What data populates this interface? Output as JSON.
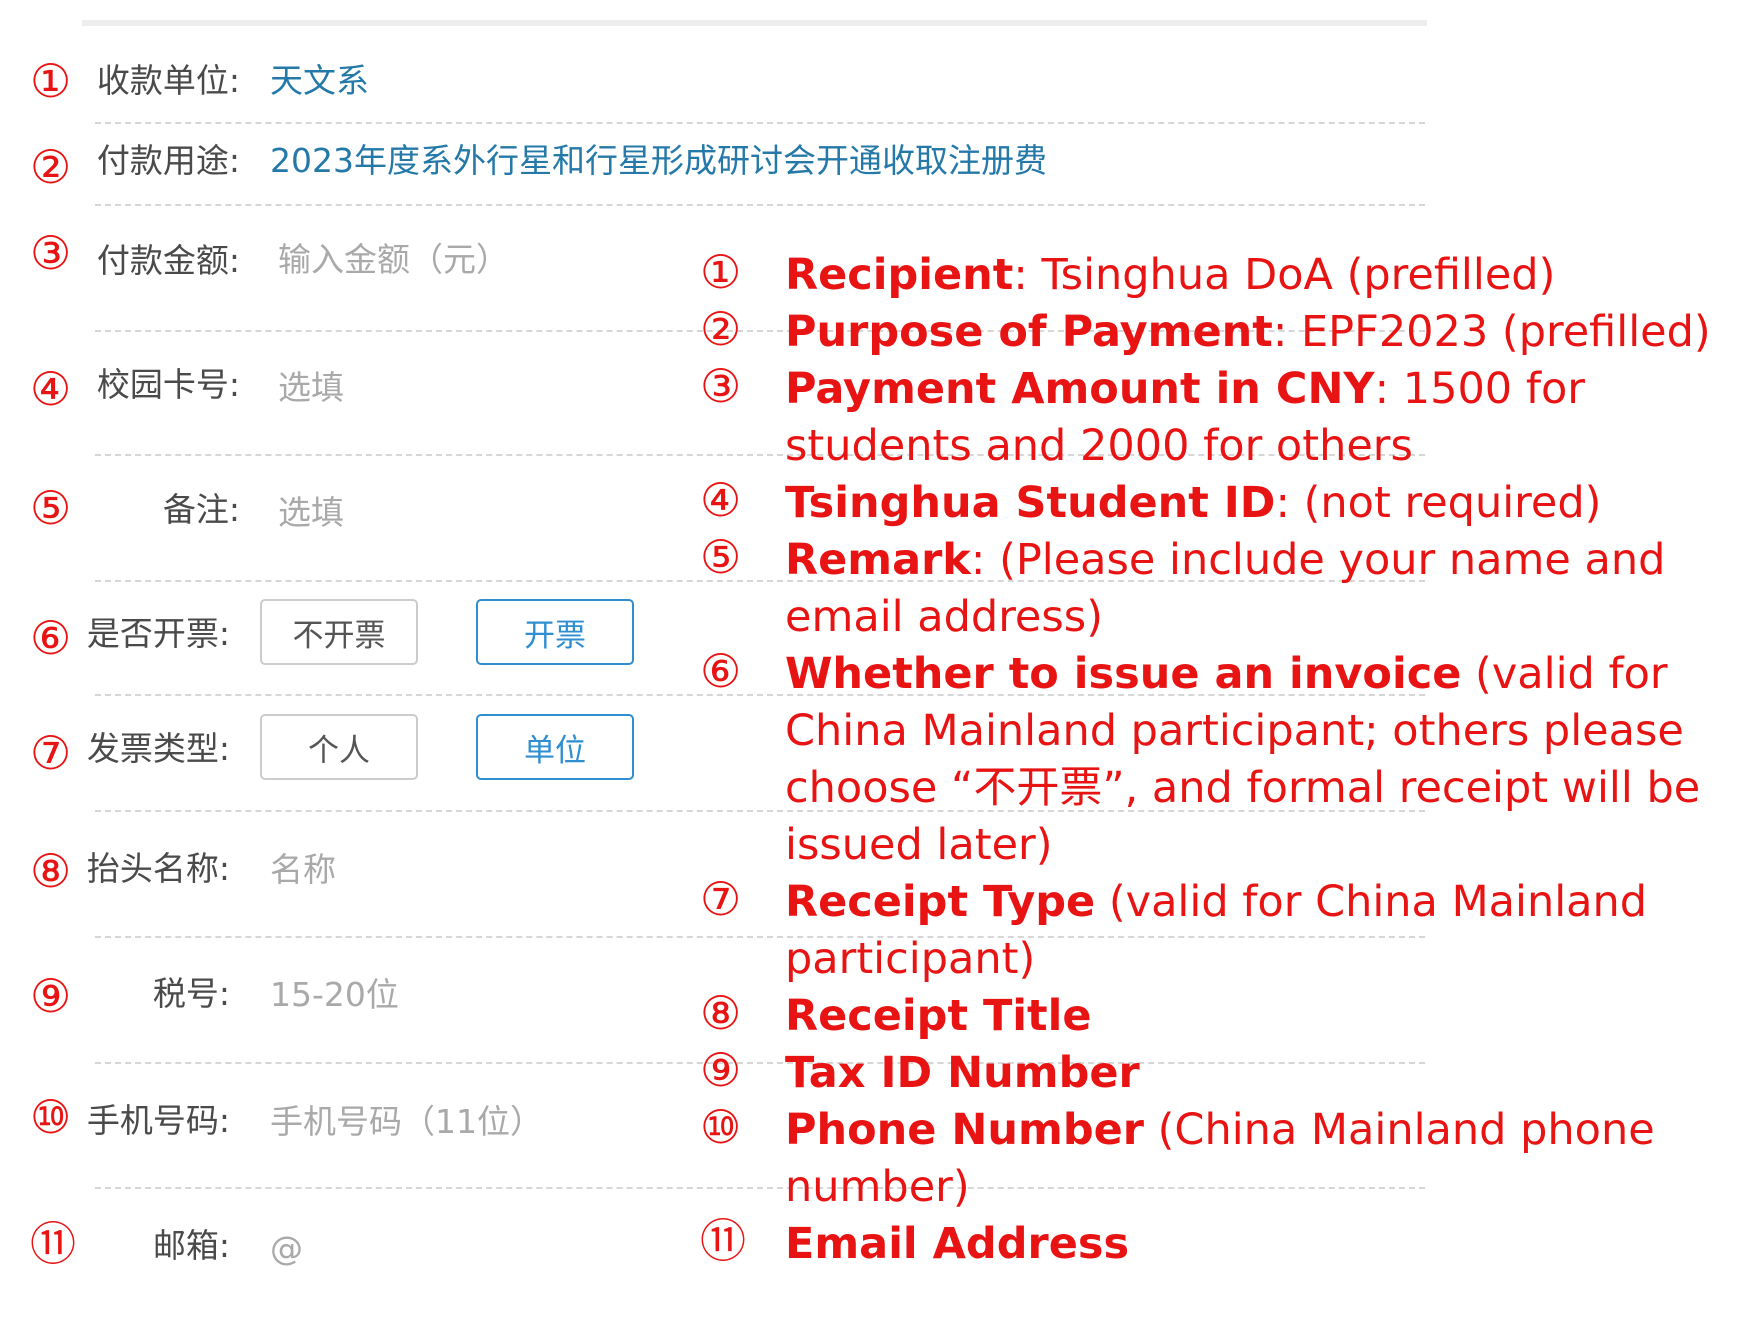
{
  "form": {
    "rows": [
      {
        "num": "①",
        "label": "收款单位:",
        "value": "天文系"
      },
      {
        "num": "②",
        "label": "付款用途:",
        "value": "2023年度系外行星和行星形成研讨会开通收取注册费"
      },
      {
        "num": "③",
        "label": "付款金额:",
        "placeholder": "输入金额（元）"
      },
      {
        "num": "④",
        "label": "校园卡号:",
        "placeholder": "选填"
      },
      {
        "num": "⑤",
        "label": "备注:",
        "placeholder": "选填"
      },
      {
        "num": "⑥",
        "label": "是否开票:",
        "options": [
          {
            "label": "不开票",
            "selected": false
          },
          {
            "label": "开票",
            "selected": true
          }
        ]
      },
      {
        "num": "⑦",
        "label": "发票类型:",
        "options": [
          {
            "label": "个人",
            "selected": false
          },
          {
            "label": "单位",
            "selected": true
          }
        ]
      },
      {
        "num": "⑧",
        "label": "抬头名称:",
        "placeholder": "名称"
      },
      {
        "num": "⑨",
        "label": "税号:",
        "placeholder": "15-20位"
      },
      {
        "num": "⑩",
        "label": "手机号码:",
        "placeholder": "手机号码（11位）"
      },
      {
        "num": "⑪",
        "label": "邮箱:",
        "placeholder": "@"
      }
    ]
  },
  "notes": [
    {
      "num": "①",
      "title": "Recipient",
      "sep": ": ",
      "text": "Tsinghua DoA (prefilled)"
    },
    {
      "num": "②",
      "title": "Purpose of Payment",
      "sep": ": ",
      "text": "EPF2023 (prefilled)"
    },
    {
      "num": "③",
      "title": "Payment Amount in CNY",
      "sep": ": ",
      "text": "1500 for students and 2000 for others"
    },
    {
      "num": "④",
      "title": "Tsinghua Student ID",
      "sep": ": ",
      "text": "(not required)"
    },
    {
      "num": "⑤",
      "title": "Remark",
      "sep": ": ",
      "text": "(Please include your name and email address)"
    },
    {
      "num": "⑥",
      "title": "Whether to issue an invoice",
      "sep": " ",
      "text": "(valid for China Mainland participant; others please choose “不开票”, and formal receipt will be issued later)"
    },
    {
      "num": "⑦",
      "title": "Receipt Type",
      "sep": " ",
      "text": "(valid for China Mainland participant)"
    },
    {
      "num": "⑧",
      "title": "Receipt Title",
      "sep": "",
      "text": ""
    },
    {
      "num": "⑨",
      "title": "Tax ID Number",
      "sep": "",
      "text": ""
    },
    {
      "num": "⑩",
      "title": "Phone Number",
      "sep": " ",
      "text": "(China Mainland phone number)"
    },
    {
      "num": "⑪",
      "title": "Email Address",
      "sep": "",
      "text": ""
    }
  ],
  "colors": {
    "annotation": "#e81414",
    "value": "#2479a8",
    "selected": "#2e8ecf",
    "label": "#4a4a4a",
    "placeholder": "#a9a9a9"
  }
}
